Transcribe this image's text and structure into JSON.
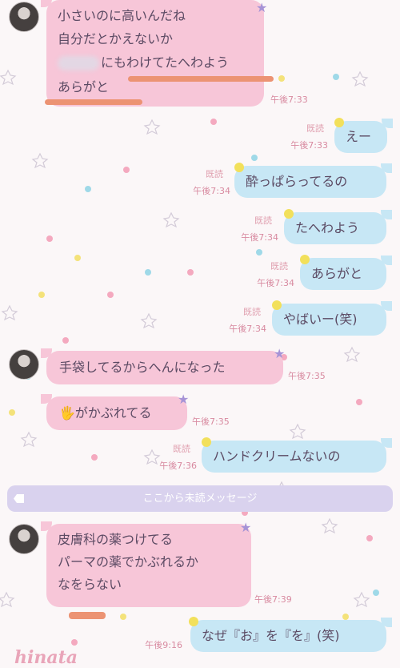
{
  "messages": [
    {
      "id": "m1",
      "side": "left",
      "lines": [
        "小さいのに高いんだね",
        "自分だとかえないか",
        "にもわけてたへわよう",
        "あらがと"
      ],
      "time": "午後7:33"
    },
    {
      "id": "m2",
      "side": "right",
      "text": "えー",
      "read": "既読",
      "time": "午後7:33"
    },
    {
      "id": "m3",
      "side": "right",
      "text": "酔っぱらってるの",
      "read": "既読",
      "time": "午後7:34"
    },
    {
      "id": "m4",
      "side": "right",
      "text": "たへわよう",
      "read": "既読",
      "time": "午後7:34"
    },
    {
      "id": "m5",
      "side": "right",
      "text": "あらがと",
      "read": "既読",
      "time": "午後7:34"
    },
    {
      "id": "m6",
      "side": "right",
      "text": "やばいー(笑)",
      "read": "既読",
      "time": "午後7:34"
    },
    {
      "id": "m7",
      "side": "left",
      "text": "手袋してるからへんになった",
      "time": "午後7:35"
    },
    {
      "id": "m8",
      "side": "left",
      "emoji": "🖐",
      "text": "がかぶれてる",
      "time": "午後7:35"
    },
    {
      "id": "m9",
      "side": "right",
      "text": "ハンドクリームないの",
      "read": "既読",
      "time": "午後7:36"
    },
    {
      "id": "m10",
      "side": "left",
      "lines": [
        "皮膚科の薬つけてる",
        "パーマの薬でかぶれるか",
        "なをらない"
      ],
      "time": "午後7:39"
    },
    {
      "id": "m11",
      "side": "right",
      "text": "なぜ『お』を『を』(笑)",
      "time": "午後9:16"
    }
  ],
  "unread_divider": "ここから未読メッセージ",
  "watermark": "hinata",
  "colors": {
    "left_bubble": "#f7c6d8",
    "right_bubble": "#c7e7f5",
    "divider": "#d9d2ee",
    "highlight": "#ec9373"
  }
}
